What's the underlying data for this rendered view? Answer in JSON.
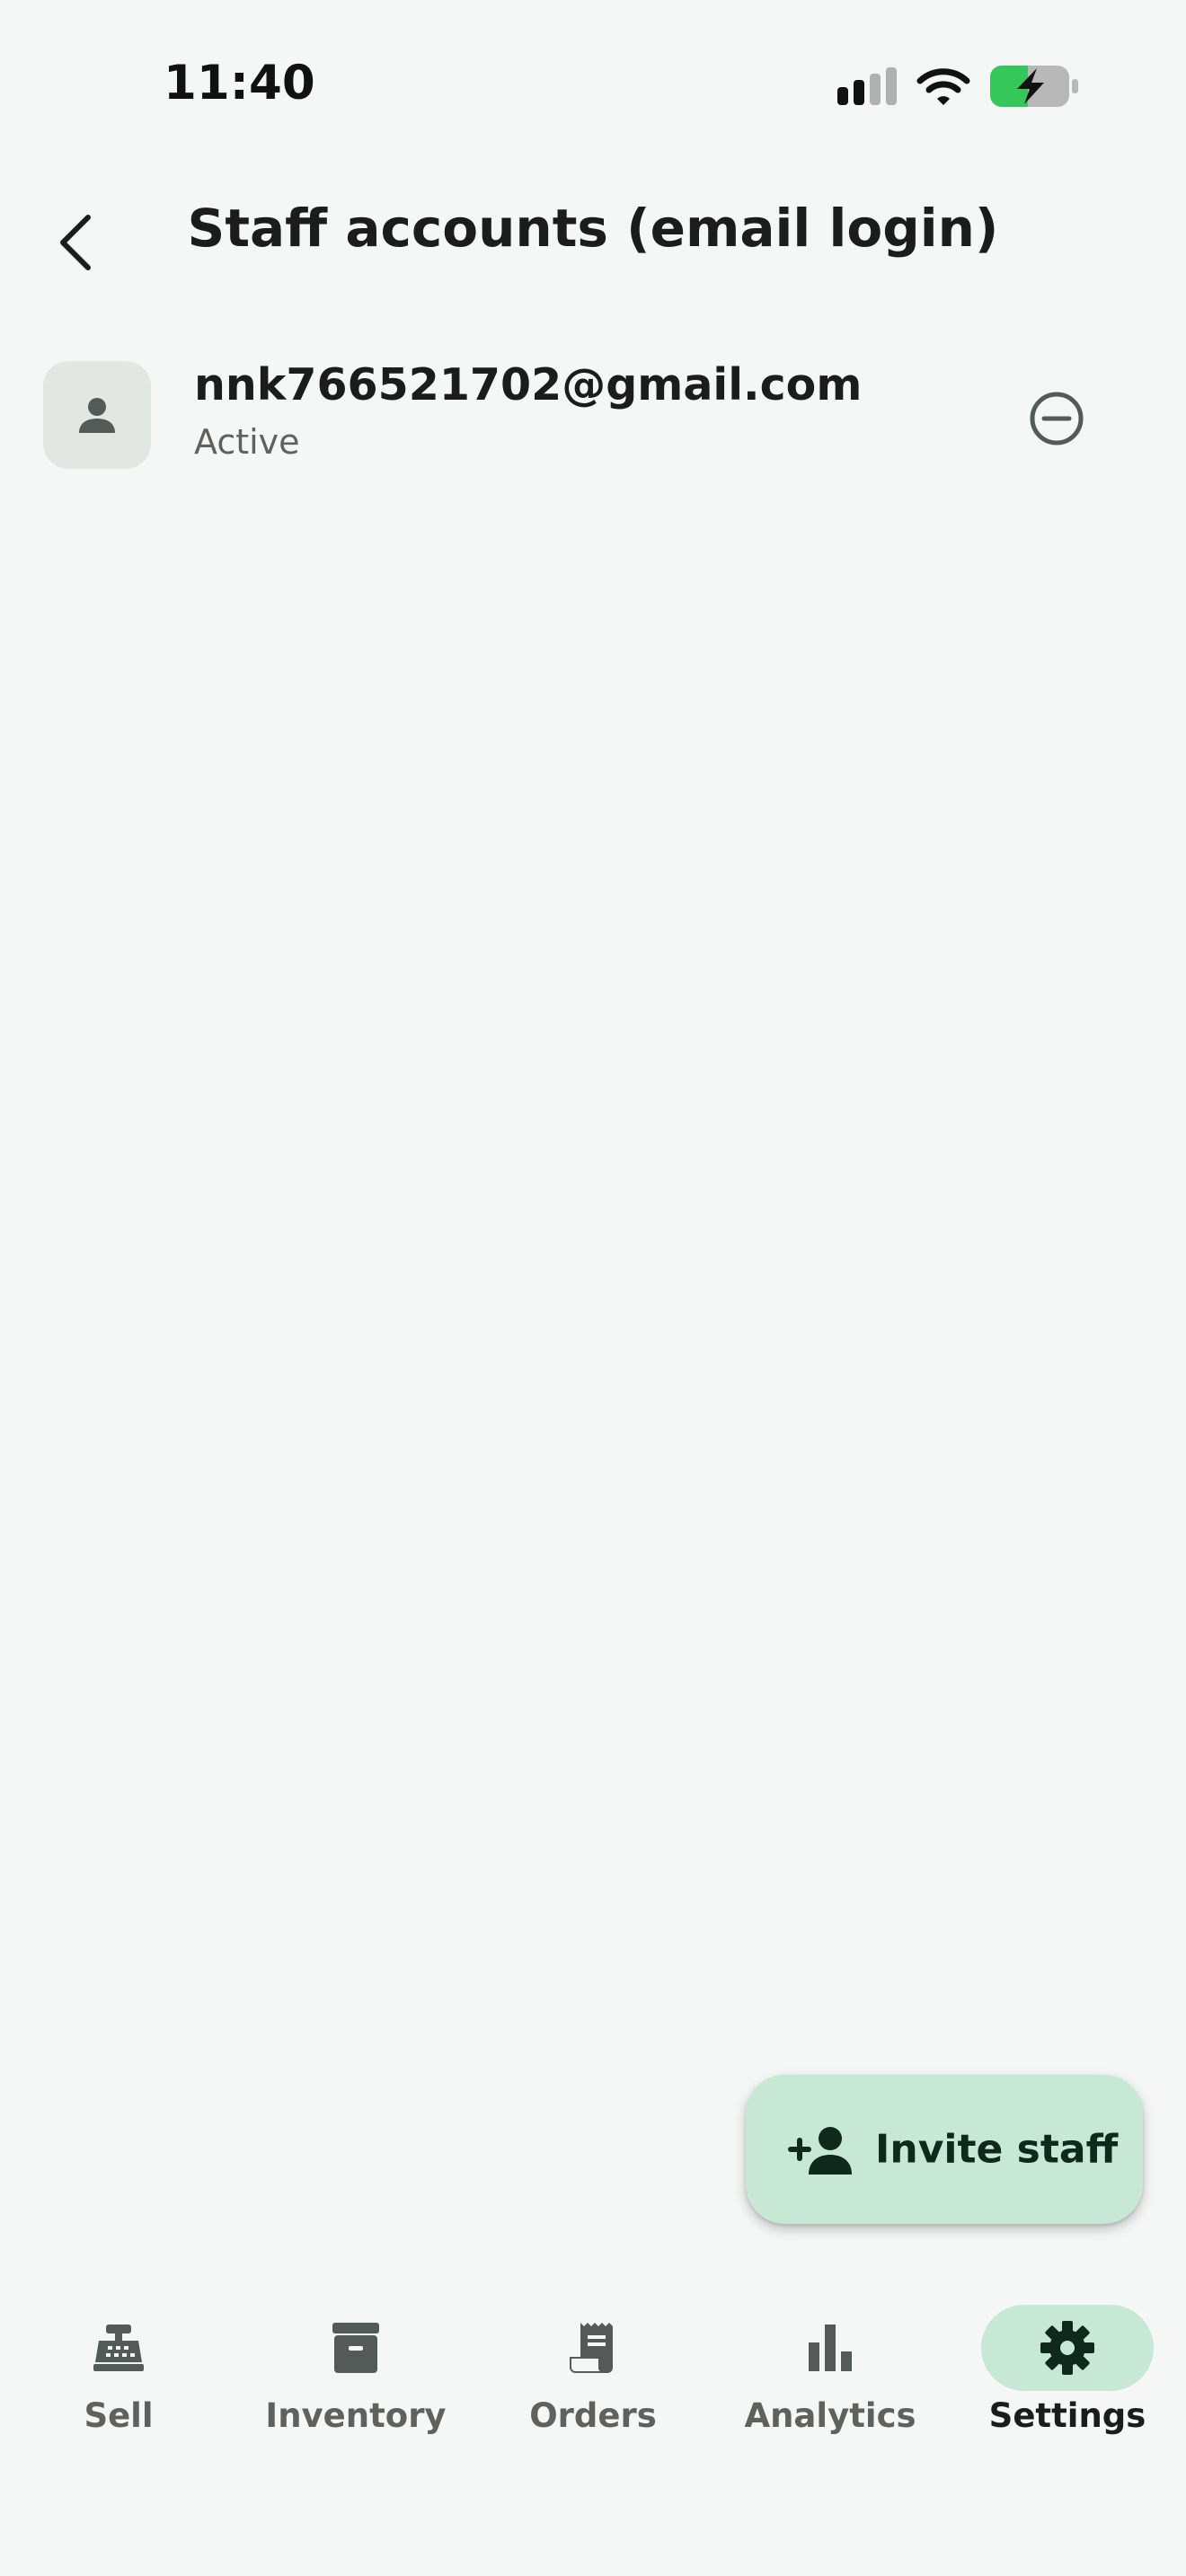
{
  "status_bar": {
    "time": "11:40",
    "icons": [
      "cellular-signal-icon",
      "wifi-icon",
      "battery-charging-icon"
    ]
  },
  "header": {
    "title": "Staff accounts (email login)",
    "back_icon": "chevron-left-icon"
  },
  "staff": [
    {
      "email": "nnk766521702@gmail.com",
      "status": "Active",
      "avatar_icon": "person-icon",
      "action_icon": "remove-circle-icon"
    }
  ],
  "fab": {
    "label": "Invite staff",
    "icon": "person-add-icon"
  },
  "bottom_nav": {
    "items": [
      {
        "label": "Sell",
        "icon": "cash-register-icon",
        "active": false
      },
      {
        "label": "Inventory",
        "icon": "archive-box-icon",
        "active": false
      },
      {
        "label": "Orders",
        "icon": "receipt-icon",
        "active": false
      },
      {
        "label": "Analytics",
        "icon": "bar-chart-icon",
        "active": false
      },
      {
        "label": "Settings",
        "icon": "gear-icon",
        "active": true
      }
    ]
  },
  "colors": {
    "background": "#f5f7f6",
    "accent_container": "#c8e8d6",
    "on_accent": "#0f2a1d",
    "icon_gray": "#545a57",
    "battery_green": "#34c759"
  }
}
